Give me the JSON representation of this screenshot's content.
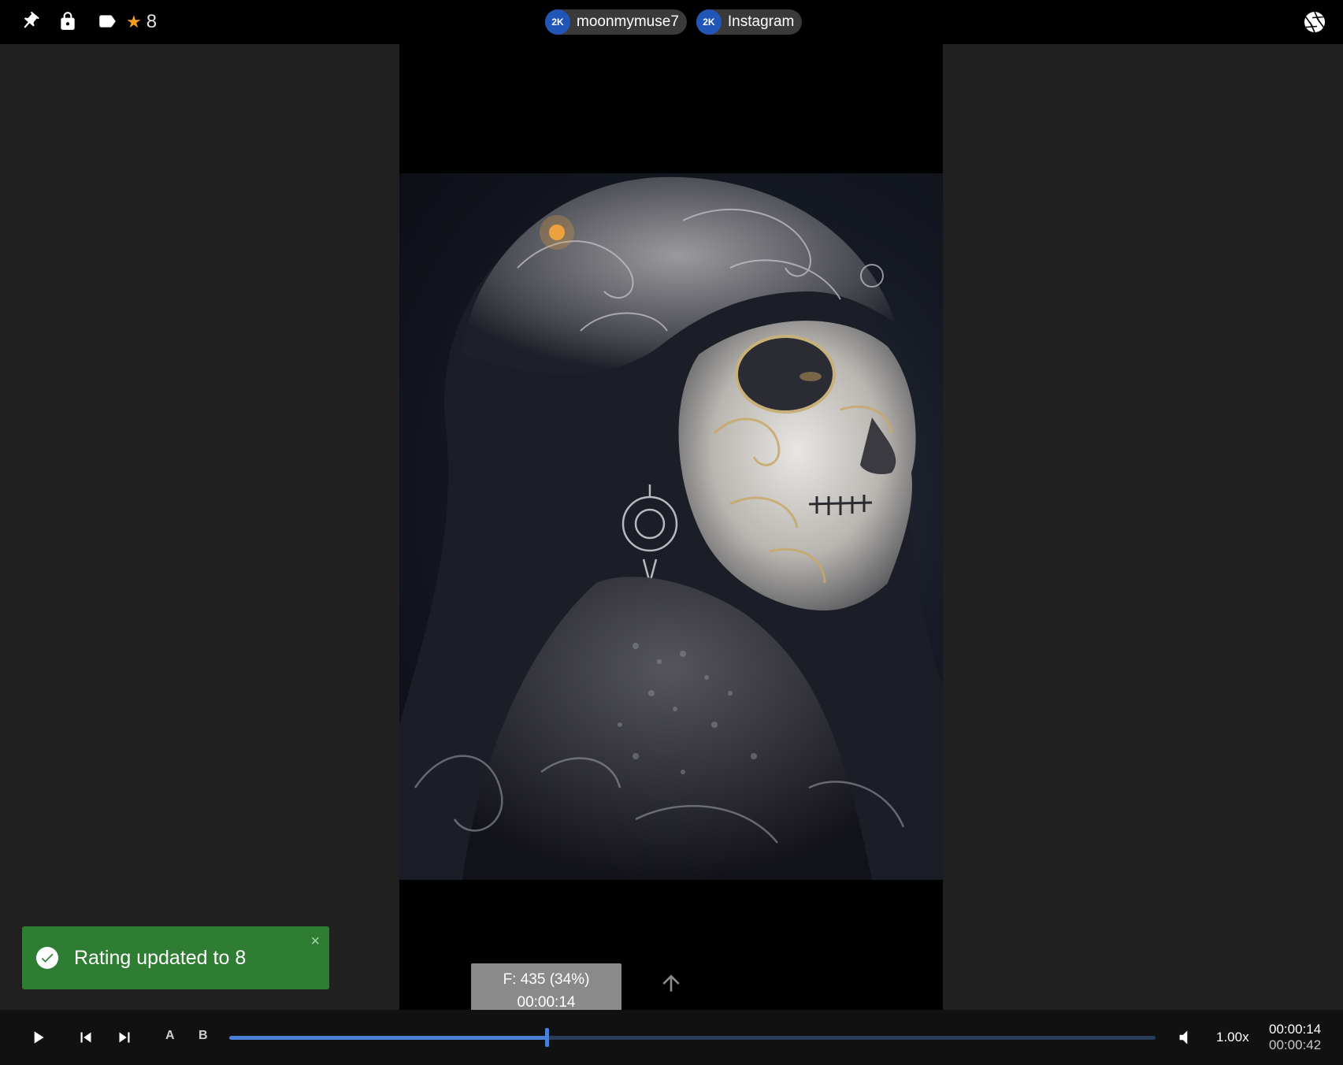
{
  "topbar": {
    "icons": [
      "pin-icon",
      "lock-icon",
      "tag-icon"
    ],
    "rating_value": "8",
    "rating_color": "#f39c22",
    "chips": [
      {
        "badge": "2K",
        "label": "moonmymuse7"
      },
      {
        "badge": "2K",
        "label": "Instagram"
      }
    ],
    "right_icon": "shutter-icon"
  },
  "scrub_tooltip": {
    "frame": "F: 435 (34%)",
    "time": "00:00:14"
  },
  "toast": {
    "message": "Rating updated to 8",
    "close": "×",
    "color": "#2e7d32"
  },
  "controls": {
    "a_label": "A",
    "b_label": "B",
    "progress": 0.343,
    "speed": "1.00x",
    "current_time": "00:00:14",
    "total_time": "00:00:42",
    "accent": "#4a7fd6"
  }
}
